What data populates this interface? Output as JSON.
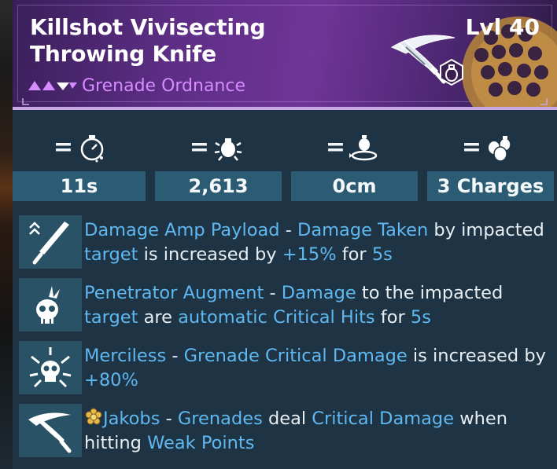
{
  "item": {
    "name": "Killshot Vivisecting Throwing Knife",
    "level": "Lvl 40",
    "type": "Grenade Ordnance"
  },
  "colors": {
    "header_purple": "#6f3597",
    "type_text": "#d68cff",
    "highlight_blue": "#5fb8f0",
    "stat_bar": "#2b5c73",
    "card_bg": "#1e3444"
  },
  "stats": [
    {
      "icon": "cooldown-timer-icon",
      "value": "11s"
    },
    {
      "icon": "damage-explosion-icon",
      "value": "2,613"
    },
    {
      "icon": "radius-icon",
      "value": "0cm"
    },
    {
      "icon": "charges-icon",
      "value": "3 Charges"
    }
  ],
  "perks": [
    {
      "icon": "knife-chevron-icon",
      "parts": [
        {
          "t": "Damage Amp Payload",
          "hl": true
        },
        {
          "t": " - ",
          "hl": false
        },
        {
          "t": "Damage Taken",
          "hl": true
        },
        {
          "t": " by impacted ",
          "hl": false
        },
        {
          "t": "target",
          "hl": true
        },
        {
          "t": " is increased by ",
          "hl": false
        },
        {
          "t": "+15%",
          "hl": true
        },
        {
          "t": " for ",
          "hl": false
        },
        {
          "t": "5s",
          "hl": true
        }
      ]
    },
    {
      "icon": "skull-spike-icon",
      "parts": [
        {
          "t": "Penetrator Augment",
          "hl": true
        },
        {
          "t": " - ",
          "hl": false
        },
        {
          "t": "Damage",
          "hl": true
        },
        {
          "t": " to the impacted ",
          "hl": false
        },
        {
          "t": "target",
          "hl": true
        },
        {
          "t": " are ",
          "hl": false
        },
        {
          "t": "automatic Critical Hits",
          "hl": true
        },
        {
          "t": " for ",
          "hl": false
        },
        {
          "t": "5s",
          "hl": true
        }
      ]
    },
    {
      "icon": "skull-burst-icon",
      "parts": [
        {
          "t": "Merciless",
          "hl": true
        },
        {
          "t": " - ",
          "hl": false
        },
        {
          "t": "Grenade Critical Damage",
          "hl": true
        },
        {
          "t": " is increased by ",
          "hl": false
        },
        {
          "t": "+80%",
          "hl": true
        }
      ]
    },
    {
      "icon": "manufacturer-knife-icon",
      "manufacturer_icon": "jakobs-flower-icon",
      "parts": [
        {
          "t": "Jakobs",
          "hl": true
        },
        {
          "t": " - ",
          "hl": false
        },
        {
          "t": "Grenades",
          "hl": true
        },
        {
          "t": " deal ",
          "hl": false
        },
        {
          "t": "Critical Damage",
          "hl": true
        },
        {
          "t": " when hitting ",
          "hl": false
        },
        {
          "t": "Weak Points",
          "hl": true
        }
      ]
    }
  ]
}
